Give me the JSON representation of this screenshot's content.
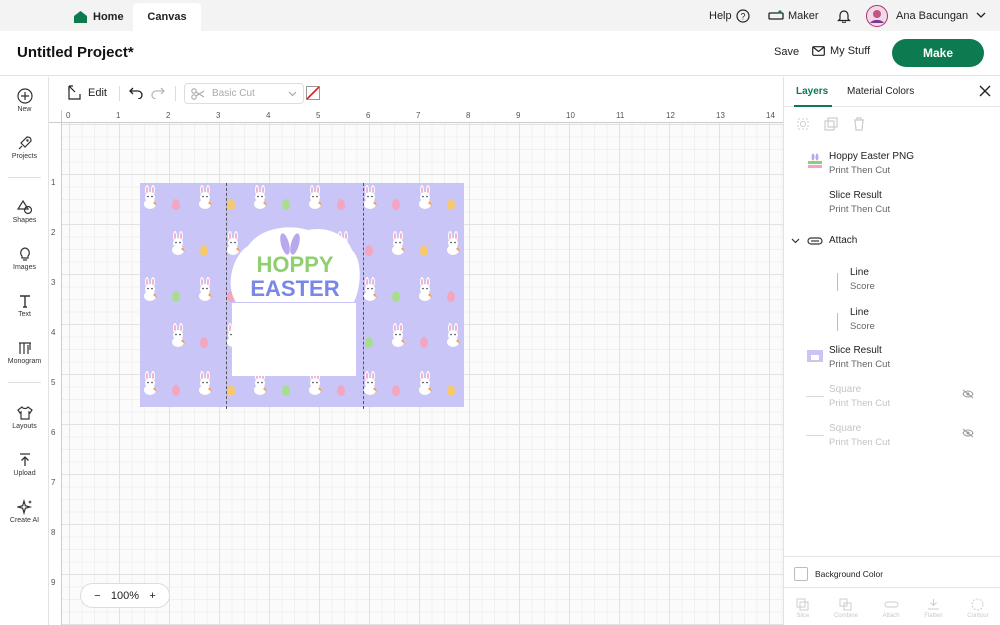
{
  "top_nav": {
    "home_label": "Home",
    "canvas_label": "Canvas",
    "help_label": "Help",
    "maker_label": "Maker",
    "user_name": "Ana Bacungan"
  },
  "project": {
    "title": "Untitled Project*",
    "save_label": "Save",
    "mystuff_label": "My Stuff",
    "make_label": "Make"
  },
  "sidebar": {
    "items": [
      {
        "label": "New",
        "icon": "plus-circle-icon"
      },
      {
        "label": "Projects",
        "icon": "rocket-icon"
      },
      {
        "label": "Shapes",
        "icon": "shapes-icon"
      },
      {
        "label": "Images",
        "icon": "bulb-icon"
      },
      {
        "label": "Text",
        "icon": "text-icon"
      },
      {
        "label": "Monogram",
        "icon": "monogram-icon"
      },
      {
        "label": "Layouts",
        "icon": "shirt-icon"
      },
      {
        "label": "Upload",
        "icon": "upload-icon"
      },
      {
        "label": "Create AI",
        "icon": "sparkle-icon"
      }
    ]
  },
  "toolbar": {
    "edit_label": "Edit",
    "operation_value": "Basic Cut"
  },
  "ruler": {
    "top": [
      "0",
      "1",
      "2",
      "3",
      "4",
      "5",
      "6",
      "7",
      "8",
      "9",
      "10",
      "11",
      "12",
      "13",
      "14"
    ],
    "left": [
      "1",
      "2",
      "3",
      "4",
      "5",
      "6",
      "7",
      "8",
      "9"
    ]
  },
  "design": {
    "word1": "HOPPY",
    "word2": "EASTER"
  },
  "zoom": {
    "minus": "−",
    "value": "100%",
    "plus": "+"
  },
  "panel": {
    "tabs": [
      "Layers",
      "Material Colors"
    ],
    "layers": [
      {
        "title": "Hoppy Easter PNG",
        "sub": "Print Then Cut"
      },
      {
        "title": "Slice Result",
        "sub": "Print Then Cut"
      },
      {
        "title": "Attach",
        "sub": ""
      },
      {
        "title": "Line",
        "sub": "Score"
      },
      {
        "title": "Line",
        "sub": "Score"
      },
      {
        "title": "Slice Result",
        "sub": "Print Then Cut"
      },
      {
        "title": "Square",
        "sub": "Print Then Cut"
      },
      {
        "title": "Square",
        "sub": "Print Then Cut"
      }
    ],
    "background_color_label": "Background Color",
    "bottom_tools": [
      "Slice",
      "Combine",
      "Attach",
      "Flatten",
      "Contour"
    ]
  },
  "colors": {
    "brand": "#0d7a4f",
    "design_bg": "#c9c6f7"
  }
}
